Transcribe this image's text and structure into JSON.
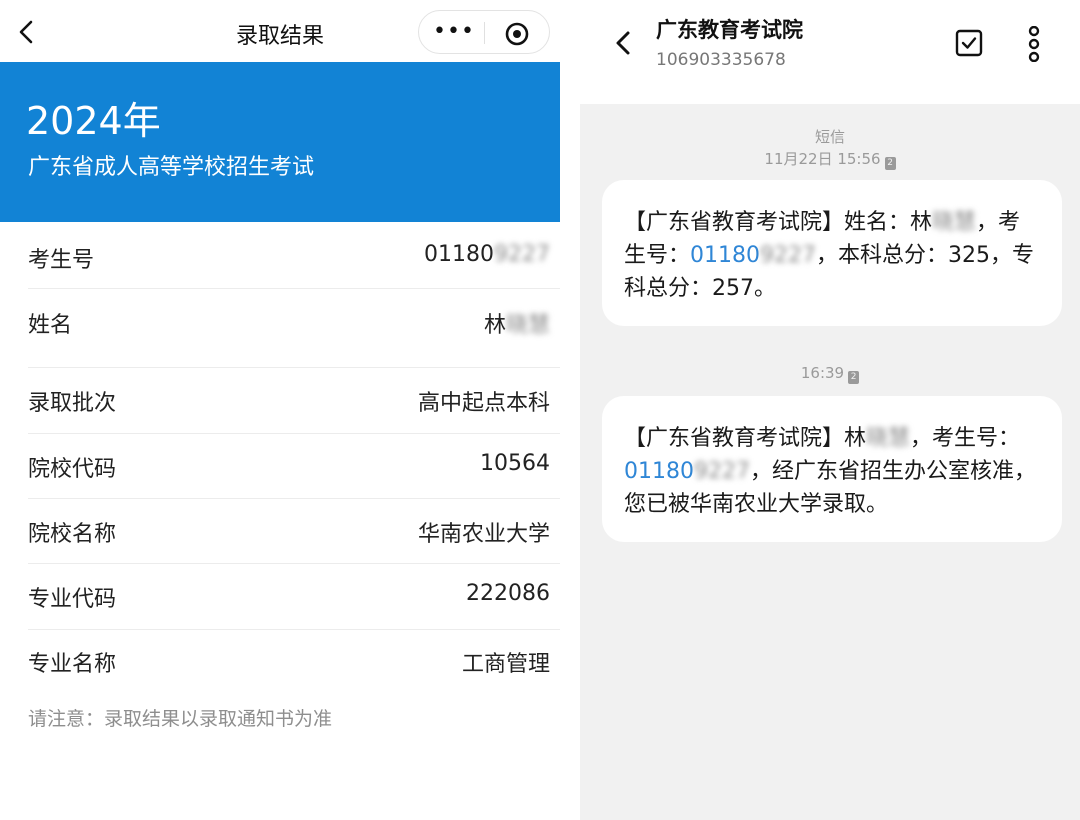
{
  "miniapp": {
    "title": "录取结果",
    "menu_glyph": "•••",
    "banner": {
      "year": "2024年",
      "subtitle": "广东省成人高等学校招生考试"
    },
    "rows": [
      {
        "label": "考生号",
        "value": "01180",
        "value_masked": "9227"
      },
      {
        "label": "姓名",
        "value": "林",
        "value_masked": "晓慧"
      },
      {
        "label": "录取批次",
        "value": "高中起点本科"
      },
      {
        "label": "院校代码",
        "value": "10564"
      },
      {
        "label": "院校名称",
        "value": "华南农业大学"
      },
      {
        "label": "专业代码",
        "value": "222086"
      },
      {
        "label": "专业名称",
        "value": "工商管理"
      }
    ],
    "notice": "请注意：录取结果以录取通知书为准",
    "colors": {
      "banner": "#1283d5"
    }
  },
  "sms": {
    "sender_name": "广东教育考试院",
    "sender_number": "106903335678",
    "channel_label": "短信",
    "messages": [
      {
        "timestamp": "11月22日 15:56",
        "sim": "2",
        "text_before_name": "【广东省教育考试院】姓名：林",
        "masked_name": "晓慧",
        "text_after_name": "，考生号：",
        "exam_no_prefix": "01180",
        "masked_exam_no": "9227",
        "text_after_no": "，本科总分：325，专科总分：257。"
      },
      {
        "timestamp": "16:39",
        "sim": "2",
        "text_before_name": "【广东省教育考试院】林",
        "masked_name": "晓慧",
        "text_after_name": "，考生号：",
        "exam_no_prefix": "01180",
        "masked_exam_no": "9227",
        "text_after_no": "，经广东省招生办公室核准，您已被华南农业大学录取。"
      }
    ],
    "colors": {
      "link": "#2f86d6",
      "background": "#f1f1f1"
    }
  }
}
